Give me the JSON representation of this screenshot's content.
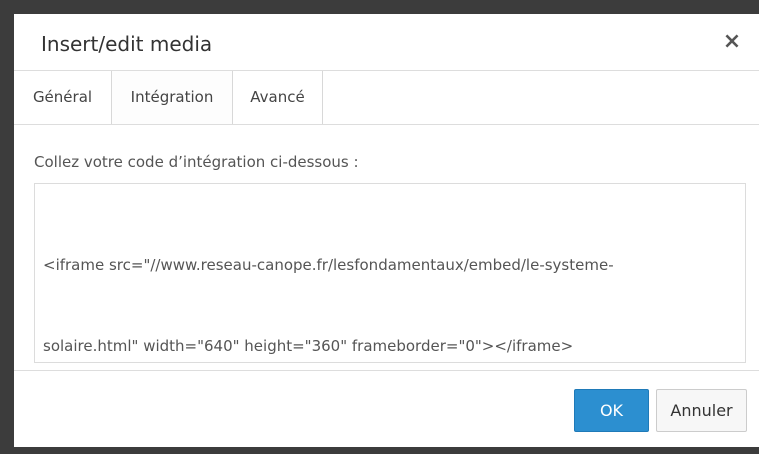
{
  "dialog": {
    "title": "Insert/edit media",
    "close_symbol": "×"
  },
  "tabs": [
    {
      "label": "Général"
    },
    {
      "label": "Intégration"
    },
    {
      "label": "Avancé"
    }
  ],
  "panel": {
    "instruction": "Collez votre code d’intégration ci-dessous :",
    "code_lines": [
      "<iframe src=\"//www.reseau-canope.fr/lesfondamentaux/embed/le-systeme-",
      "solaire.html\" width=\"640\" height=\"360\" frameborder=\"0\"></iframe>"
    ]
  },
  "footer": {
    "ok_label": "OK",
    "cancel_label": "Annuler"
  }
}
